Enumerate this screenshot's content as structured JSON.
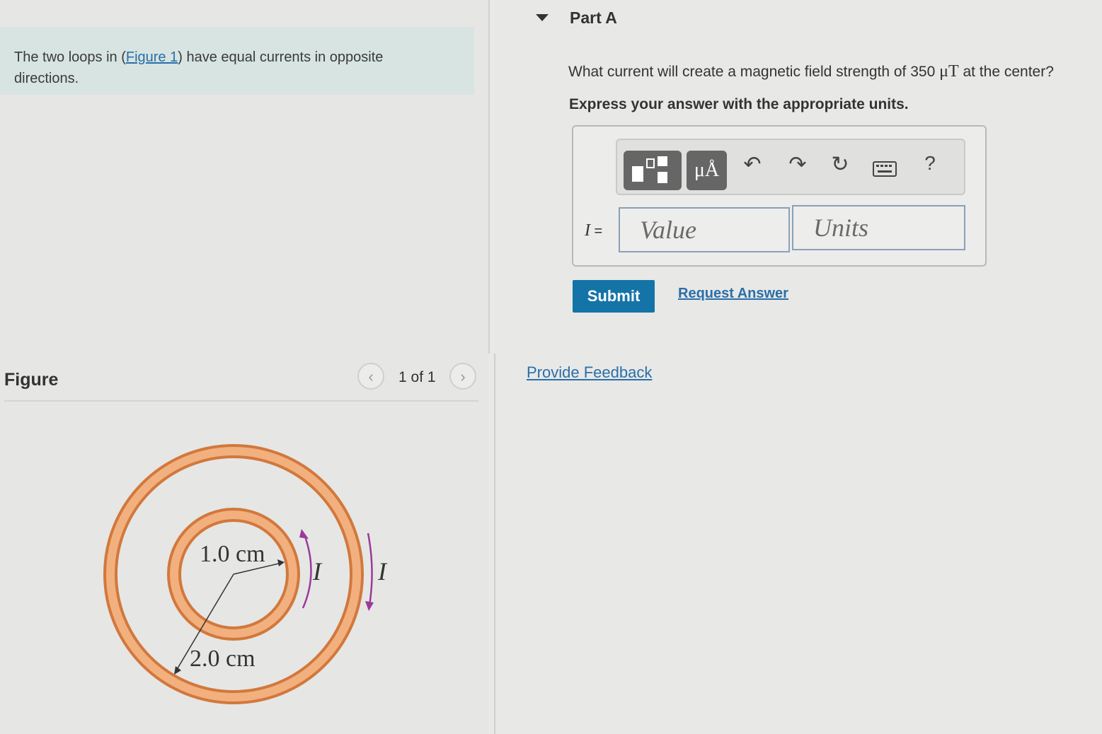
{
  "intro": {
    "text_before": "The two loops in (",
    "figure_link": "Figure 1",
    "text_after": ") have equal currents in opposite directions."
  },
  "figure_panel": {
    "title": "Figure",
    "pager": "1 of 1",
    "prev_icon": "chevron-left-icon",
    "next_icon": "chevron-right-icon",
    "inner_radius_label": "1.0 cm",
    "outer_radius_label": "2.0 cm",
    "current_label_inner": "I",
    "current_label_outer": "I",
    "loop_color": "#e8955a",
    "arrow_color": "#9a3a9a"
  },
  "part": {
    "title": "Part A",
    "question_before": "What current will create a magnetic field strength of 350 ",
    "question_unit": "μT",
    "question_after": " at the center?",
    "instruction": "Express your answer with the appropriate units."
  },
  "toolbar": {
    "templates_icon": "templates-icon",
    "units_label": "μÅ",
    "undo_icon": "undo-icon",
    "redo_icon": "redo-icon",
    "reset_icon": "reset-icon",
    "keyboard_icon": "keyboard-icon",
    "help_label": "?"
  },
  "answer": {
    "variable": "I",
    "equals": " =",
    "value_placeholder": "Value",
    "units_placeholder": "Units"
  },
  "actions": {
    "submit_label": "Submit",
    "request_label": "Request Answer",
    "feedback_label": "Provide Feedback"
  },
  "colors": {
    "accent": "#1474a8",
    "link": "#2a6fa8",
    "intro_bg": "#d7e4e1"
  }
}
